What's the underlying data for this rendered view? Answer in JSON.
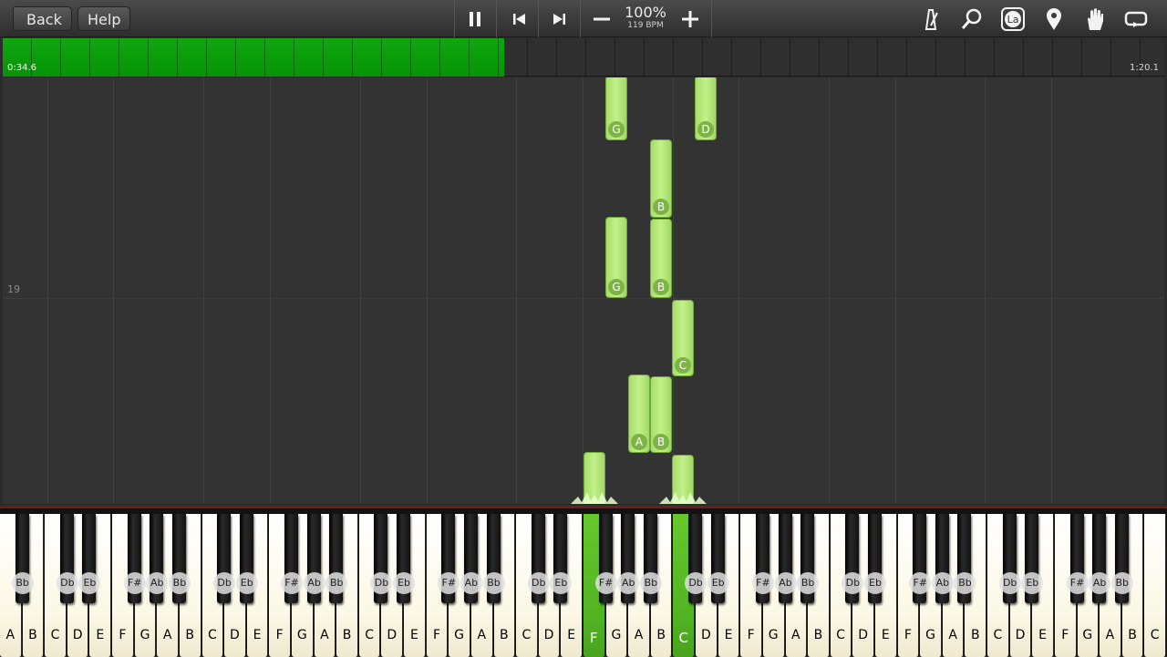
{
  "toolbar": {
    "back_label": "Back",
    "help_label": "Help",
    "zoom": "100%",
    "bpm": "119 BPM",
    "icons": [
      "pause-icon",
      "skip-back-icon",
      "skip-forward-icon",
      "minus-icon",
      "plus-icon",
      "metronome-icon",
      "search-icon",
      "note-label-icon",
      "marker-icon",
      "hand-icon",
      "loop-icon"
    ],
    "note_label_icon_text": "La"
  },
  "timeline": {
    "current": "0:34.6",
    "total": "1:20.1",
    "progress": 0.432
  },
  "roll": {
    "measure_number": "19",
    "notes": [
      "G",
      "D",
      "B",
      "G",
      "B",
      "C",
      "A",
      "B",
      "",
      ""
    ]
  },
  "keyboard": {
    "white_keys": [
      "A",
      "B",
      "C",
      "D",
      "E",
      "F",
      "G",
      "A",
      "B",
      "C",
      "D",
      "E",
      "F",
      "G",
      "A",
      "B",
      "C",
      "D",
      "E",
      "F",
      "G",
      "A",
      "B",
      "C",
      "D",
      "E",
      "F",
      "G",
      "A",
      "B",
      "C",
      "D",
      "E",
      "F",
      "G",
      "A",
      "B",
      "C",
      "D",
      "E",
      "F",
      "G",
      "A",
      "B",
      "C",
      "D",
      "E",
      "F",
      "G",
      "A",
      "B",
      "C"
    ],
    "black_keys": [
      "Bb",
      "Db",
      "Eb",
      "F#",
      "Ab",
      "Bb",
      "Db",
      "Eb",
      "F#",
      "Ab",
      "Bb",
      "Db",
      "Eb",
      "F#",
      "Ab",
      "Bb",
      "Db",
      "Eb",
      "F#",
      "Ab",
      "Bb",
      "Db",
      "Eb",
      "F#",
      "Ab",
      "Bb",
      "Db",
      "Eb",
      "F#",
      "Ab",
      "Bb",
      "Db",
      "Eb",
      "F#",
      "Ab",
      "Bb"
    ],
    "pressed": [
      "F",
      "C"
    ]
  },
  "colors": {
    "accent_green": "#0fa60f",
    "note_green": "#b5e87a"
  }
}
